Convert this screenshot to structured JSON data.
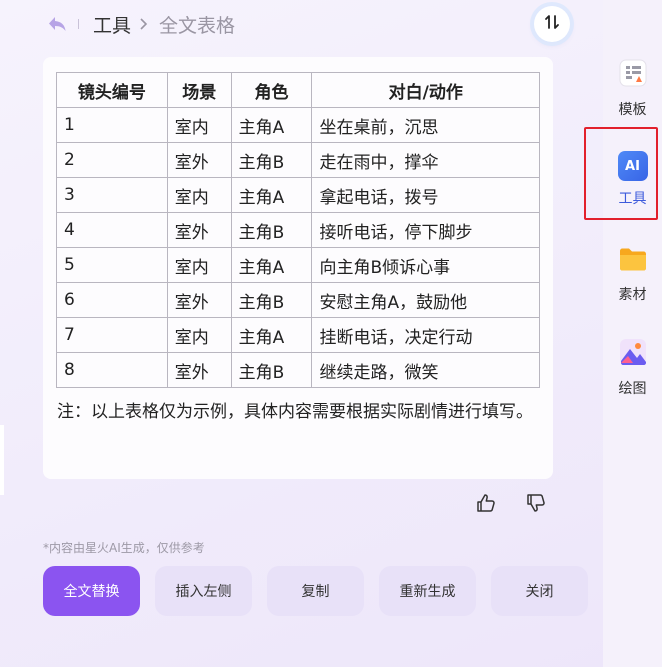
{
  "header": {
    "breadcrumb_parent": "工具",
    "breadcrumb_current": "全文表格"
  },
  "table": {
    "headers": [
      "镜头编号",
      "场景",
      "角色",
      "对白/动作"
    ],
    "rows": [
      [
        "1",
        "室内",
        "主角A",
        "坐在桌前，沉思"
      ],
      [
        "2",
        "室外",
        "主角B",
        "走在雨中，撑伞"
      ],
      [
        "3",
        "室内",
        "主角A",
        "拿起电话，拨号"
      ],
      [
        "4",
        "室外",
        "主角B",
        "接听电话，停下脚步"
      ],
      [
        "5",
        "室内",
        "主角A",
        "向主角B倾诉心事"
      ],
      [
        "6",
        "室外",
        "主角B",
        "安慰主角A，鼓励他"
      ],
      [
        "7",
        "室内",
        "主角A",
        "挂断电话，决定行动"
      ],
      [
        "8",
        "室外",
        "主角B",
        "继续走路，微笑"
      ]
    ]
  },
  "note": "注：以上表格仅为示例，具体内容需要根据实际剧情进行填写。",
  "disclaimer": "*内容由星火AI生成，仅供参考",
  "actions": {
    "replace_all": "全文替换",
    "insert_left": "插入左侧",
    "copy": "复制",
    "regenerate": "重新生成",
    "close": "关闭"
  },
  "rail": {
    "templates": "模板",
    "tools": "工具",
    "materials": "素材",
    "drawing": "绘图",
    "ai_badge": "AI"
  },
  "colors": {
    "primary": "#8b54f0",
    "button_bg": "#e8e1f8",
    "active_blue": "#3d5bdc",
    "highlight_red": "#e2202c"
  }
}
